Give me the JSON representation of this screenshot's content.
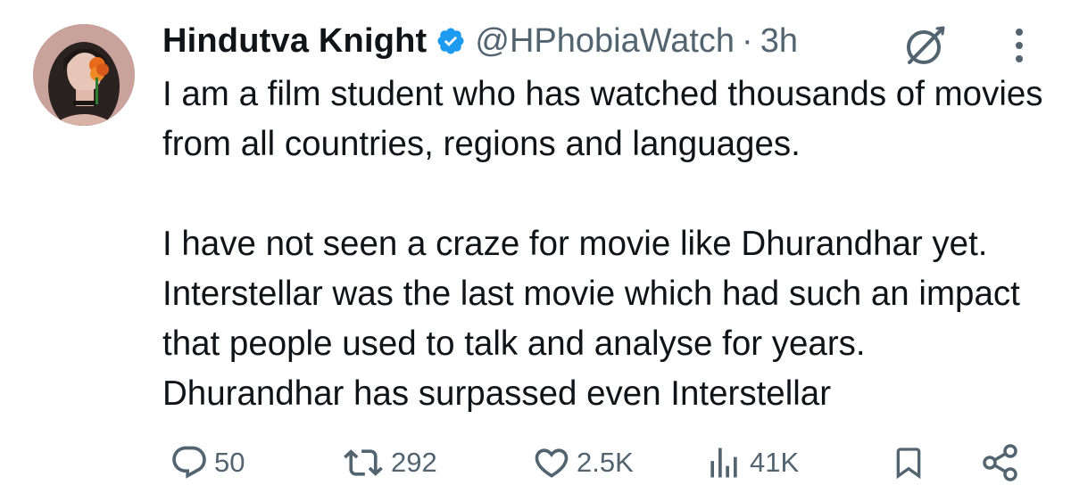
{
  "tweet": {
    "author": {
      "display_name": "Hindutva Knight",
      "handle": "@HPhobiaWatch",
      "verified": true,
      "time_separator": "·",
      "time": "3h"
    },
    "icons": {
      "verified": "verified-badge-icon",
      "grok": "grok-icon",
      "more": "more-vertical-icon"
    },
    "body": {
      "paragraph_1": "I am a film student who has watched thousands of movies from all countries, regions and languages.",
      "paragraph_2": "I have not seen a craze for movie like Dhurandhar yet. Interstellar was the last movie which had such an impact that people used to talk and analyse for years. Dhurandhar has surpassed even Interstellar"
    },
    "actions": {
      "replies": "50",
      "reposts": "292",
      "likes": "2.5K",
      "views": "41K"
    },
    "colors": {
      "text": "#0f1419",
      "secondary": "#536471",
      "verified_blue": "#1d9bf0"
    }
  }
}
